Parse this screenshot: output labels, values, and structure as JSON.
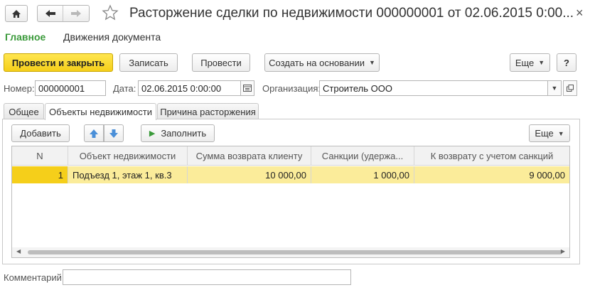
{
  "header": {
    "title": "Расторжение сделки по недвижимости 000000001 от 02.06.2015 0:00...",
    "close_glyph": "×"
  },
  "menu": {
    "main": "Главное",
    "movements": "Движения документа"
  },
  "toolbar": {
    "post_close": "Провести и закрыть",
    "save": "Записать",
    "post": "Провести",
    "create_based": "Создать на основании",
    "more": "Еще",
    "help": "?"
  },
  "fields": {
    "number_label": "Номер:",
    "number_value": "000000001",
    "date_label": "Дата:",
    "date_value": "02.06.2015  0:00:00",
    "org_label": "Организация:",
    "org_value": "Строитель ООО"
  },
  "tabs": [
    {
      "label": "Общее"
    },
    {
      "label": "Объекты недвижимости"
    },
    {
      "label": "Причина расторжения"
    }
  ],
  "table_toolbar": {
    "add": "Добавить",
    "fill": "Заполнить",
    "more": "Еще"
  },
  "table": {
    "columns": [
      "N",
      "Объект недвижимости",
      "Сумма возврата клиенту",
      "Санкции (удержа...",
      "К возврату с учетом санкций"
    ],
    "rows": [
      [
        "1",
        "Подъезд 1, этаж 1, кв.3",
        "10 000,00",
        "1 000,00",
        "9 000,00"
      ]
    ]
  },
  "comment": {
    "label": "Комментарий:",
    "value": ""
  },
  "colors": {
    "accent_green": "#3a9a3a",
    "primary_button": "#f5cf1a",
    "selected_row": "#fbec9a"
  }
}
